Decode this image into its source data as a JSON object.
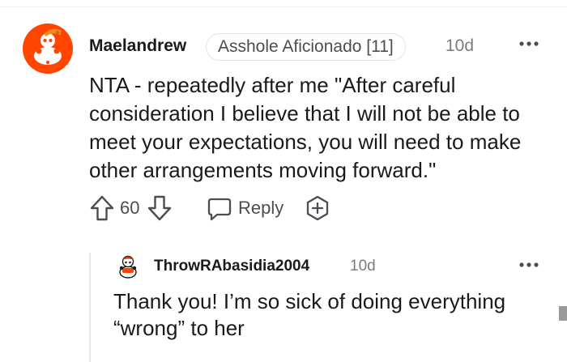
{
  "comment": {
    "author": "Maelandrew",
    "flair": "Asshole Aficionado [11]",
    "age": "10d",
    "body": "NTA - repeatedly after me \"After careful consideration I believe that I will not be able to meet your expectations, you will need to make other arrangements moving forward.\"",
    "score": "60",
    "reply_label": "Reply",
    "icons": {
      "avatar": "snoo-avatar-icon",
      "more": "more-options-icon",
      "upvote": "upvote-arrow-icon",
      "downvote": "downvote-arrow-icon",
      "reply": "chat-bubble-icon",
      "award": "award-plus-icon"
    }
  },
  "reply": {
    "author": "ThrowRAbasidia2004",
    "age": "10d",
    "body": "Thank you! I’m so sick of doing everything “wrong” to her"
  },
  "colors": {
    "snoo_red": "#ff4500",
    "hat_orange": "#f08c1e",
    "text": "#1a1a1b",
    "meta": "#7c7c7c",
    "icon_gray": "#4a4e52",
    "thread_line": "#e4e6e8"
  }
}
